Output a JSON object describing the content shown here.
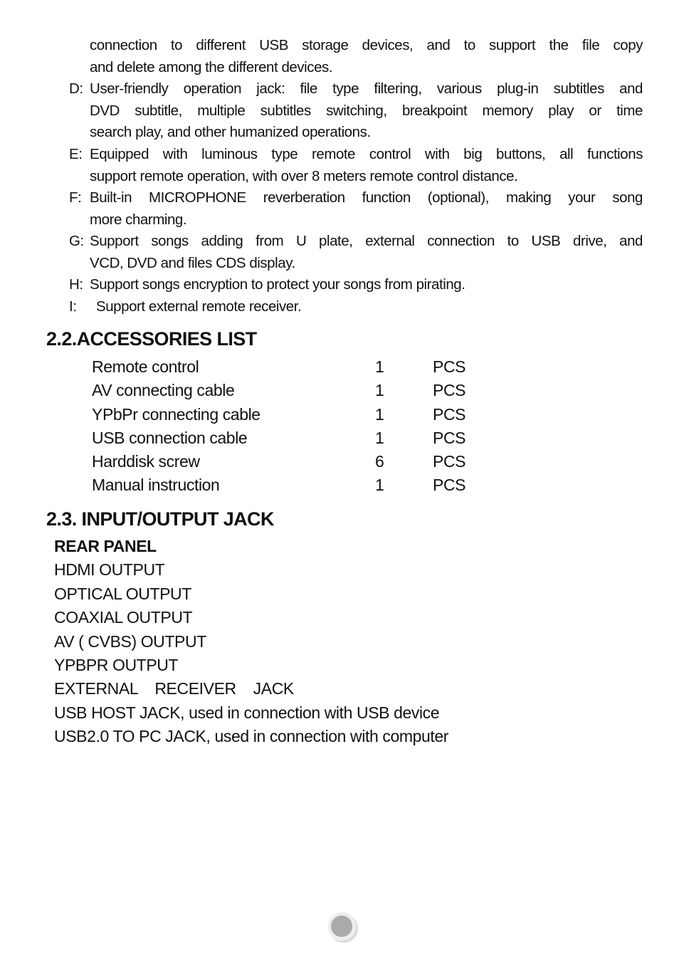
{
  "continuation": {
    "line1": "connection to different USB storage devices, and to support the file copy",
    "line2": "and delete among the different devices."
  },
  "features": [
    {
      "label": "D:",
      "lines": [
        "User-friendly operation jack: file type filtering, various plug-in subtitles and",
        "DVD subtitle, multiple subtitles switching, breakpoint memory play or time",
        "search play, and other humanized operations."
      ]
    },
    {
      "label": "E:",
      "lines": [
        "Equipped with luminous type remote control with big buttons, all functions",
        "support remote operation, with over 8 meters remote control distance."
      ]
    },
    {
      "label": "F:",
      "lines": [
        "Built-in MICROPHONE reverberation function (optional), making your song",
        "more charming."
      ]
    },
    {
      "label": "G:",
      "lines": [
        "Support songs adding from U plate, external connection to USB drive, and",
        "VCD, DVD and files CDS display."
      ]
    },
    {
      "label": "H:",
      "lines": [
        "Support songs encryption to protect your songs from pirating."
      ]
    },
    {
      "label": "I:",
      "lines": [
        "Support external remote receiver."
      ]
    }
  ],
  "accessories": {
    "heading": "2.2.ACCESSORIES LIST",
    "items": [
      {
        "name": "Remote control",
        "qty": "1",
        "unit": "PCS"
      },
      {
        "name": "AV connecting cable",
        "qty": "1",
        "unit": "PCS"
      },
      {
        "name": "YPbPr connecting cable",
        "qty": "1",
        "unit": "PCS"
      },
      {
        "name": "USB connection cable",
        "qty": "1",
        "unit": "PCS"
      },
      {
        "name": "Harddisk screw",
        "qty": "6",
        "unit": "PCS"
      },
      {
        "name": "Manual instruction",
        "qty": "1",
        "unit": "PCS"
      }
    ]
  },
  "io": {
    "heading": "2.3. INPUT/OUTPUT JACK",
    "subheading": "REAR PANEL",
    "items": [
      "HDMI OUTPUT",
      "OPTICAL OUTPUT",
      "COAXIAL OUTPUT",
      "AV ( CVBS) OUTPUT",
      "YPBPR OUTPUT",
      "EXTERNAL    RECEIVER    JACK",
      "USB HOST JACK, used in connection with USB device",
      "USB2.0 TO PC JACK, used in connection with computer"
    ]
  },
  "page_marker": {
    "icon": "page-dot-icon",
    "fill": "#aaaaaa",
    "ring": "#eeeeee"
  }
}
